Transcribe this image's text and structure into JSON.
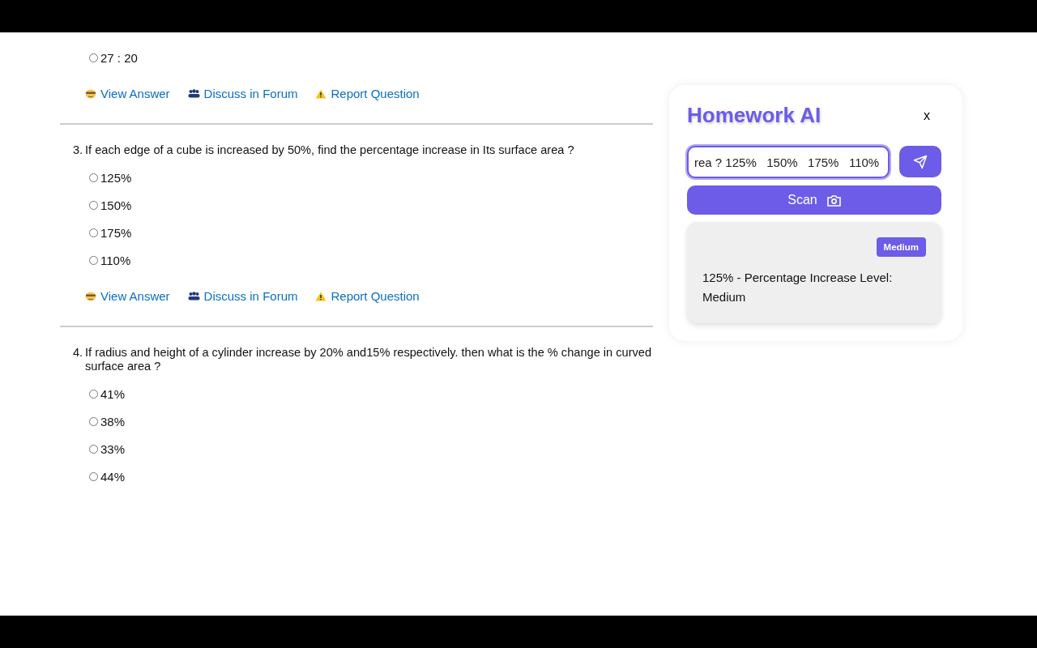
{
  "questions": [
    {
      "options": [
        {
          "label": "27 : 20",
          "selected": false
        }
      ],
      "actions": [
        {
          "kind": "answer",
          "label": "View Answer"
        },
        {
          "kind": "forum",
          "label": "Discuss in Forum"
        },
        {
          "kind": "report",
          "label": "Report Question"
        }
      ]
    },
    {
      "number": "3.",
      "text": "If each edge of a cube is increased by 50%, find the percentage increase in Its surface area ?",
      "options": [
        {
          "label": "125%",
          "selected": false
        },
        {
          "label": "150%",
          "selected": false
        },
        {
          "label": "175%",
          "selected": false
        },
        {
          "label": "110%",
          "selected": false
        }
      ],
      "actions": [
        {
          "kind": "answer",
          "label": "View Answer"
        },
        {
          "kind": "forum",
          "label": "Discuss in Forum"
        },
        {
          "kind": "report",
          "label": "Report Question"
        }
      ]
    },
    {
      "number": "4.",
      "text": "If radius and height of a cylinder increase by 20% and15% respectively. then what is the % change in curved surface area ?",
      "options": [
        {
          "label": "41%",
          "selected": false
        },
        {
          "label": "38%",
          "selected": false
        },
        {
          "label": "33%",
          "selected": false
        },
        {
          "label": "44%",
          "selected": false
        }
      ]
    }
  ],
  "assistant": {
    "title": "Homework AI",
    "close": "x",
    "input_value": "rea ? 125%   150%   175%   110%",
    "scan_label": "Scan",
    "result": {
      "badge": "Medium",
      "text": "125% - Percentage Increase Level: Medium"
    }
  }
}
